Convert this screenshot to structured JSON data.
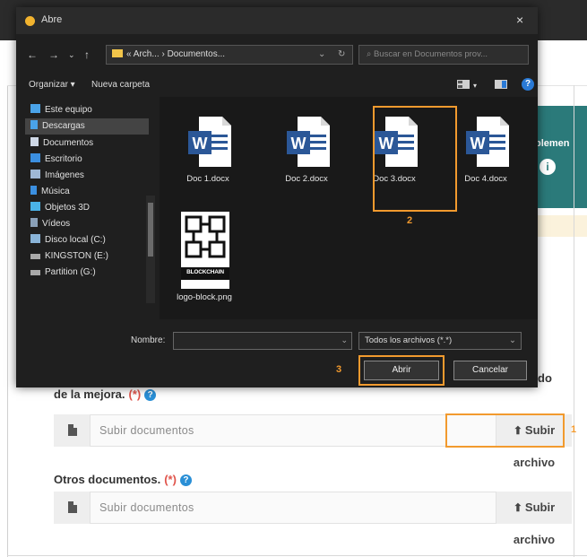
{
  "dialog": {
    "title": "Abre",
    "close_label": "×",
    "address": {
      "path": "« Arch... › Documentos...",
      "chevron": "⌄",
      "refresh": "↻"
    },
    "search_placeholder": "Buscar en Documentos prov...",
    "toolbar": {
      "organize": "Organizar ▾",
      "new_folder": "Nueva carpeta",
      "help": "?"
    },
    "nav_items": [
      {
        "label": "Este equipo",
        "icon": "computer-icon",
        "color": "#4aa3e8"
      },
      {
        "label": "Descargas",
        "icon": "download-icon",
        "color": "#4aa3e8",
        "selected": true
      },
      {
        "label": "Documentos",
        "icon": "documents-icon",
        "color": "#cfd8e6"
      },
      {
        "label": "Escritorio",
        "icon": "desktop-icon",
        "color": "#3b8fe0"
      },
      {
        "label": "Imágenes",
        "icon": "pictures-icon",
        "color": "#9fb8d6"
      },
      {
        "label": "Música",
        "icon": "music-icon",
        "color": "#3b8fe0"
      },
      {
        "label": "Objetos 3D",
        "icon": "objects3d-icon",
        "color": "#4ab3e8"
      },
      {
        "label": "Vídeos",
        "icon": "videos-icon",
        "color": "#8aa0b8"
      },
      {
        "label": "Disco local (C:)",
        "icon": "drive-icon",
        "color": "#8ab4d8"
      },
      {
        "label": "KINGSTON (E:)",
        "icon": "usb-drive-icon",
        "color": "#aaaaaa"
      },
      {
        "label": "Partition (G:)",
        "icon": "drive-icon",
        "color": "#aaaaaa"
      }
    ],
    "files": [
      {
        "label": "Doc 1.docx",
        "type": "word"
      },
      {
        "label": "Doc 2.docx",
        "type": "word"
      },
      {
        "label": "Doc 3.docx",
        "type": "word",
        "highlighted": true
      },
      {
        "label": "Doc 4.docx",
        "type": "word"
      },
      {
        "label": "logo-block.png",
        "type": "image",
        "image_text": "BLOCKCHAIN"
      }
    ],
    "filename_label": "Nombre:",
    "filename_value": "",
    "filetype": "Todos los archivos (*.*)",
    "open_button": "Abrir",
    "cancel_button": "Cancelar",
    "step_2": "2",
    "step_3": "3"
  },
  "page": {
    "teal_text": "plemen",
    "info_glyph": "i",
    "label_fragment": "do",
    "sections": [
      {
        "label": "de la mejora.",
        "required": "(*)",
        "placeholder": "Subir documentos",
        "button": "Subir archivo",
        "highlighted": true
      },
      {
        "label": "Otros documentos.",
        "required": "(*)",
        "placeholder": "Subir documentos",
        "button": "Subir archivo",
        "highlighted": false
      }
    ],
    "step_1": "1",
    "colors": {
      "accent_orange": "#f29a2e",
      "teal": "#2b7a7a",
      "word_blue": "#2b5797"
    }
  }
}
